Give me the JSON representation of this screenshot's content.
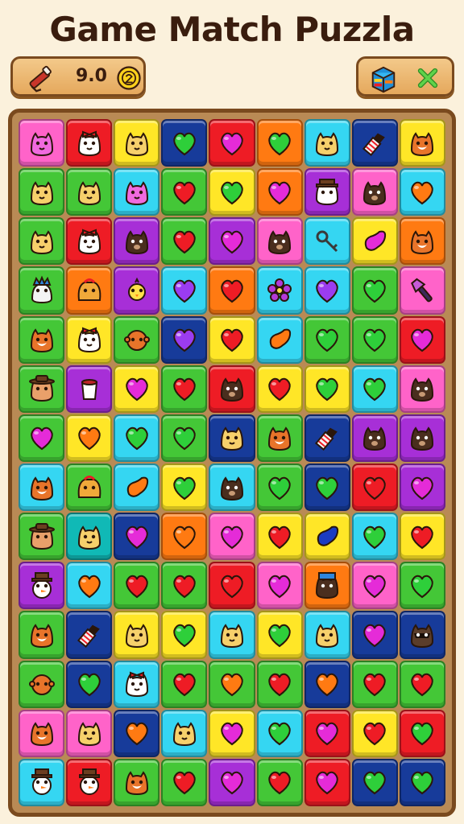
{
  "title": "Game Match Puzzla",
  "toolbar": {
    "score": "9.0"
  },
  "icons": {
    "tool": "tool-icon",
    "coin": "coin-icon",
    "crate": "crate-icon",
    "close": "close-icon"
  },
  "colors": {
    "pink": "#ff63c9",
    "red": "#ee1c25",
    "yellow": "#ffe627",
    "navy": "#173b9a",
    "orange": "#ff7a12",
    "cyan": "#35d6f2",
    "green": "#44c737",
    "purple": "#a72fd7",
    "teal": "#10b9b6"
  },
  "board": {
    "columns": 9,
    "rows": 14,
    "cells": [
      [
        "pink:cat-pink",
        "red:cat-bow",
        "yellow:cat",
        "navy:heart-green",
        "red:heart-magenta",
        "orange:heart-green",
        "cyan:cat",
        "navy:lipstick",
        "yellow:fox"
      ],
      [
        "green:cat",
        "green:cat",
        "cyan:cat-pink",
        "green:heart-red",
        "yellow:heart-green",
        "orange:heart-magenta",
        "purple:cat-hat",
        "pink:bear",
        "cyan:heart-orange"
      ],
      [
        "green:cat",
        "red:cat-bow",
        "purple:bear",
        "green:heart-red",
        "purple:heart-magenta",
        "pink:bear",
        "cyan:key",
        "yellow:bean-magenta",
        "orange:fox"
      ],
      [
        "green:dog-crown",
        "orange:dog-bag",
        "purple:chick",
        "cyan:heart-purple",
        "orange:heart-red",
        "cyan:flower",
        "cyan:heart-purple",
        "green:heart-green",
        "pink:brush"
      ],
      [
        "green:fox",
        "yellow:cat-bow",
        "green:monkey",
        "navy:heart-purple",
        "yellow:heart-red",
        "cyan:bean-orange",
        "green:heart-green",
        "green:heart-green",
        "red:heart-magenta"
      ],
      [
        "green:dog-hat",
        "purple:cup",
        "yellow:heart-magenta",
        "green:heart-red",
        "red:bear",
        "yellow:heart-red",
        "yellow:heart-green",
        "cyan:heart-green",
        "pink:bear"
      ],
      [
        "green:heart-magenta",
        "yellow:heart-orange",
        "cyan:heart-green",
        "green:heart-green",
        "navy:cat",
        "green:fox",
        "navy:lipstick",
        "purple:bear",
        "purple:bear"
      ],
      [
        "cyan:fox",
        "green:dog-bag",
        "cyan:bean-orange",
        "yellow:heart-green",
        "cyan:bear",
        "green:heart-green",
        "navy:heart-green",
        "red:heart-red",
        "purple:heart-magenta"
      ],
      [
        "green:dog-hat",
        "teal:cat",
        "navy:heart-magenta",
        "orange:heart-orange",
        "pink:heart-magenta",
        "yellow:heart-red",
        "yellow:bean-navy",
        "cyan:heart-green",
        "yellow:heart-red"
      ],
      [
        "purple:snowman-hat",
        "cyan:heart-orange",
        "green:heart-red",
        "green:heart-red",
        "red:heart-red",
        "pink:heart-magenta",
        "orange:bear-hat",
        "pink:heart-magenta",
        "green:heart-green"
      ],
      [
        "green:fox",
        "navy:lipstick",
        "yellow:cat",
        "yellow:heart-green",
        "cyan:cat",
        "yellow:heart-green",
        "cyan:cat",
        "navy:heart-magenta",
        "navy:raccoon"
      ],
      [
        "green:monkey",
        "navy:heart-green",
        "cyan:cat-bow",
        "green:heart-red",
        "green:heart-orange",
        "green:heart-red",
        "navy:heart-orange",
        "green:heart-red",
        "green:heart-red"
      ],
      [
        "pink:fox",
        "pink:cat",
        "navy:heart-orange",
        "cyan:cat",
        "yellow:heart-magenta",
        "cyan:heart-green",
        "red:heart-magenta",
        "yellow:heart-red",
        "red:heart-green"
      ],
      [
        "cyan:snowman-hat",
        "red:snowman-hat",
        "green:fox",
        "green:heart-red",
        "purple:heart-magenta",
        "green:heart-red",
        "red:heart-magenta",
        "navy:heart-green",
        "navy:heart-green"
      ]
    ]
  }
}
